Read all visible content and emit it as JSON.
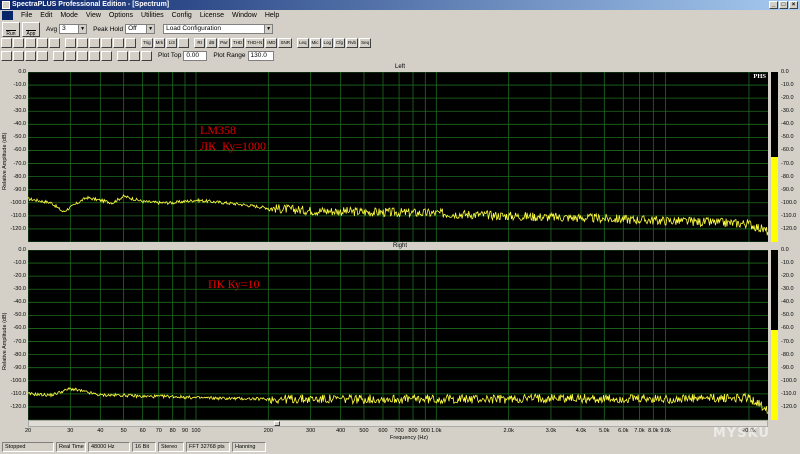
{
  "window": {
    "title": "SpectraPLUS Professional Edition - [Spectrum]"
  },
  "menu": [
    "File",
    "Edit",
    "Mode",
    "View",
    "Options",
    "Utilities",
    "Config",
    "License",
    "Window",
    "Help"
  ],
  "toolbar1": {
    "run_label": "Run",
    "app_label": "App",
    "avg_label": "Avg",
    "avg_value": "3",
    "peak_hold_label": "Peak Hold",
    "peak_hold_value": "Off",
    "config_value": "Load Configuration"
  },
  "toolbar2": [
    "",
    "",
    "",
    "",
    "",
    "",
    "",
    "",
    "",
    "",
    "",
    "Trig",
    "Mrk",
    "1/3",
    "",
    "Rt",
    "dB",
    "Pwr",
    "THD",
    "THD+N",
    "IMD",
    "SNR",
    "Leq",
    "Mic",
    "Log",
    "Cfg",
    "Rvb",
    "Seq"
  ],
  "toolbar3": {
    "plot_top_label": "Plot Top",
    "plot_top_value": "0.00",
    "plot_range_label": "Plot Range",
    "plot_range_value": "130.0"
  },
  "chart_data": [
    {
      "type": "line",
      "title": "Left",
      "ylabel": "Relative Amplitude (dB)",
      "xlabel": "Frequency (Hz)",
      "ylim": [
        -130,
        0
      ],
      "xlim": [
        20,
        24000
      ],
      "xscale": "log",
      "y_ticks": [
        "0.0",
        "-10.0",
        "-20.0",
        "-30.0",
        "-40.0",
        "-50.0",
        "-60.0",
        "-70.0",
        "-80.0",
        "-90.0",
        "-100.0",
        "-110.0",
        "-120.0"
      ],
      "series_color": "#ffff40",
      "series": [
        {
          "x": [
            20,
            25,
            28,
            35,
            45,
            50,
            60,
            70,
            80,
            100,
            150,
            200,
            300,
            500,
            1000,
            2000,
            3000,
            5000,
            10000,
            20000,
            24000
          ],
          "values": [
            -97,
            -100,
            -107,
            -96,
            -100,
            -95,
            -99,
            -100,
            -100,
            -98,
            -101,
            -104,
            -106,
            -107,
            -108,
            -110,
            -111,
            -112,
            -114,
            -116,
            -122
          ]
        }
      ],
      "annotation": "LM358\nЛК  Ку=1000",
      "badge": "PHS",
      "meter_level": 0.5,
      "meter_ticks": [
        "0.0",
        "-10.0",
        "-20.0",
        "-30.0",
        "-40.0",
        "-50.0",
        "-60.0",
        "-70.0",
        "-80.0",
        "-90.0",
        "-100.0",
        "-110.0",
        "-120.0"
      ]
    },
    {
      "type": "line",
      "title": "Right",
      "ylabel": "Relative Amplitude (dB)",
      "xlabel": "Frequency (Hz)",
      "ylim": [
        -130,
        0
      ],
      "xlim": [
        20,
        24000
      ],
      "xscale": "log",
      "y_ticks": [
        "0.0",
        "-10.0",
        "-20.0",
        "-30.0",
        "-40.0",
        "-50.0",
        "-60.0",
        "-70.0",
        "-80.0",
        "-90.0",
        "-100.0",
        "-110.0",
        "-120.0"
      ],
      "series_color": "#ffff40",
      "series": [
        {
          "x": [
            20,
            25,
            30,
            40,
            50,
            60,
            80,
            100,
            200,
            500,
            1000,
            2000,
            3000,
            5000,
            10000,
            20000,
            24000
          ],
          "values": [
            -110,
            -111,
            -106,
            -111,
            -111,
            -112,
            -112,
            -113,
            -114,
            -114,
            -114,
            -114,
            -113,
            -114,
            -114,
            -113,
            -122
          ]
        }
      ],
      "annotation": "ПК Ку=10",
      "meter_level": 0.53,
      "meter_ticks": [
        "0.0",
        "-10.0",
        "-20.0",
        "-30.0",
        "-40.0",
        "-50.0",
        "-60.0",
        "-70.0",
        "-80.0",
        "-90.0",
        "-100.0",
        "-110.0",
        "-120.0"
      ]
    }
  ],
  "x_axis": {
    "ticks": [
      {
        "f": 20,
        "label": "20"
      },
      {
        "f": 30,
        "label": "30"
      },
      {
        "f": 40,
        "label": "40"
      },
      {
        "f": 50,
        "label": "50"
      },
      {
        "f": 60,
        "label": "60"
      },
      {
        "f": 70,
        "label": "70"
      },
      {
        "f": 80,
        "label": "80"
      },
      {
        "f": 90,
        "label": "90"
      },
      {
        "f": 100,
        "label": "100"
      },
      {
        "f": 200,
        "label": "200"
      },
      {
        "f": 300,
        "label": "300"
      },
      {
        "f": 400,
        "label": "400"
      },
      {
        "f": 500,
        "label": "500"
      },
      {
        "f": 600,
        "label": "600"
      },
      {
        "f": 700,
        "label": "700"
      },
      {
        "f": 800,
        "label": "800"
      },
      {
        "f": 900,
        "label": "900"
      },
      {
        "f": 1000,
        "label": "1.0k"
      },
      {
        "f": 2000,
        "label": "2.0k"
      },
      {
        "f": 3000,
        "label": "3.0k"
      },
      {
        "f": 4000,
        "label": "4.0k"
      },
      {
        "f": 5000,
        "label": "5.0k"
      },
      {
        "f": 6000,
        "label": "6.0k"
      },
      {
        "f": 7000,
        "label": "7.0k"
      },
      {
        "f": 8000,
        "label": "8.0k"
      },
      {
        "f": 9000,
        "label": "9.0k"
      },
      {
        "f": 20000,
        "label": "20.0k"
      }
    ],
    "label": "Frequency (Hz)"
  },
  "statusbar": [
    "Stopped",
    "Real Time",
    "48000 Hz",
    "16 Bit",
    "Stereo",
    "FFT 32768 pts",
    "Hanning"
  ],
  "watermark": "MYSKU"
}
